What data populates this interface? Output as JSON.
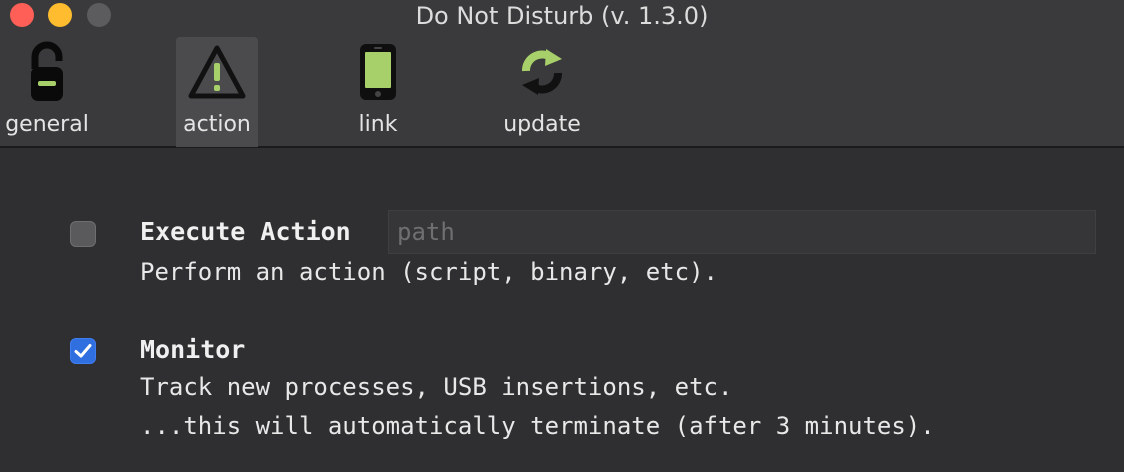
{
  "window": {
    "title": "Do Not Disturb (v. 1.3.0)"
  },
  "toolbar": {
    "tabs": [
      {
        "id": "general",
        "label": "general",
        "icon": "lock-icon"
      },
      {
        "id": "action",
        "label": "action",
        "icon": "warning-icon",
        "active": true
      },
      {
        "id": "link",
        "label": "link",
        "icon": "phone-icon"
      },
      {
        "id": "update",
        "label": "update",
        "icon": "refresh-icon"
      }
    ]
  },
  "options": {
    "execute_action": {
      "title": "Execute Action",
      "description": "Perform an action (script, binary, etc).",
      "checked": false,
      "path_placeholder": "path",
      "path_value": ""
    },
    "monitor": {
      "title": "Monitor",
      "description_line1": "Track new processes, USB insertions, etc.",
      "description_line2": "...this will automatically terminate (after 3 minutes).",
      "checked": true
    }
  },
  "colors": {
    "background": "#2f2f31",
    "toolbar": "#3a3a3c",
    "checkbox_on": "#2f6fe0",
    "icon_green": "#a8d06a"
  }
}
